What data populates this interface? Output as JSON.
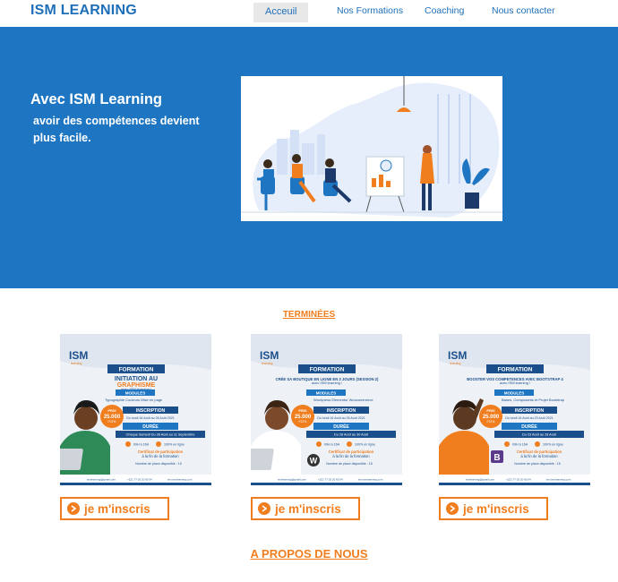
{
  "header": {
    "brand": "ISM LEARNING",
    "nav": [
      {
        "label": "Acceuil",
        "active": true
      },
      {
        "label": "Nos Formations",
        "active": false
      },
      {
        "label": "Coaching",
        "active": false
      },
      {
        "label": "Nous contacter",
        "active": false
      }
    ]
  },
  "hero": {
    "title": "Avec ISM Learning",
    "subtitle": "avoir des compétences devient plus facile."
  },
  "sections": {
    "terminees": "TERMINÉES",
    "apropos": "A PROPOS DE NOUS"
  },
  "cards": [
    {
      "formation_label": "FORMATION",
      "course_title_1": "INITIATION AU",
      "course_title_2": "GRAPHISME",
      "provider": "avec ISM learning !",
      "modules_label": "MODULES",
      "modules": "Typographie   Couleurs   Mise en page",
      "inscription_label": "INSCRIPTION",
      "inscription": "Du lundi 16 Août au 26 Août 2021",
      "duree_label": "DURÉE",
      "duree": "Chaque Samedi Du 28 Août au 11 Septembre",
      "price_label": "PRIX",
      "price": "25.000",
      "currency": "FCFA",
      "button": "je m'inscris"
    },
    {
      "formation_label": "FORMATION",
      "course_title_1": "CRÉE SA BOUTIQUE EN LIGNE EN 3 JOURS (SESSION 2)",
      "course_title_2": "",
      "provider": "avec ISM learning !",
      "modules_label": "MODULES",
      "modules": "Wordpress   Elementor   Woocommerce",
      "inscription_label": "INSCRIPTION",
      "inscription": "Du lundi 16 Août au 26 Août 2021",
      "duree_label": "DURÉE",
      "duree": "Du 28 Août au 30 Août",
      "price_label": "PRIX",
      "price": "25.000",
      "currency": "FCFA",
      "button": "je m'inscris"
    },
    {
      "formation_label": "FORMATION",
      "course_title_1": "BOOSTER VOS COMPETENCES AVEC BOOTSTRAP 4",
      "course_title_2": "",
      "provider": "avec ISM learning !",
      "modules_label": "MODULES",
      "modules": "Bases, Composants et Projet Bootstrap",
      "inscription_label": "INSCRIPTION",
      "inscription": "Du lundi 16 Août au 23 Août 2021",
      "duree_label": "DURÉE",
      "duree": "Du 23 Août au 28 Août",
      "price_label": "PRIX",
      "price": "25.000",
      "currency": "FCFA",
      "button": "je m'inscris"
    }
  ],
  "poster_common": {
    "logo": "ISM",
    "logo_sub": "learning",
    "hours": "09H à 16H",
    "mode": "100% en ligne",
    "certificate_1": "Certificat de participation",
    "certificate_2": "à la fin de la formation",
    "places": "Nombre de place disponible : 15",
    "email": "ismlearning@gmail.com",
    "phone": "+221 77 02 20 60 04",
    "site": "ism.ismlearning.com"
  },
  "colors": {
    "brand_blue": "#1e76c2",
    "accent_orange": "#f07d1e",
    "poster_navy": "#1b4f8c"
  }
}
